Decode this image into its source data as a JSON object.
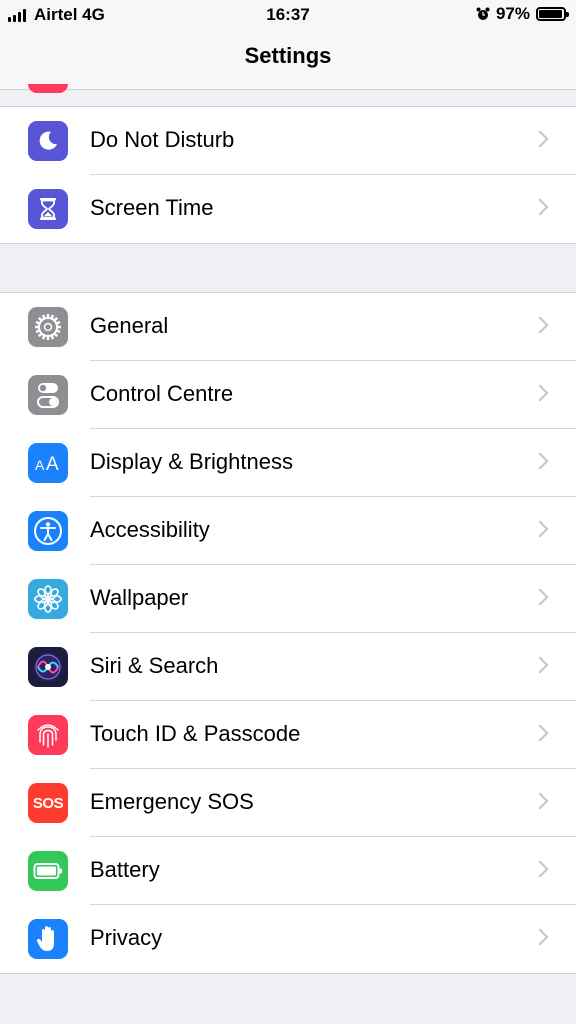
{
  "status_bar": {
    "carrier": "Airtel 4G",
    "time": "16:37",
    "battery": "97%",
    "battery_level": 0.97
  },
  "nav": {
    "title": "Settings"
  },
  "group1": [
    {
      "label": "Do Not Disturb",
      "icon": "moon-icon",
      "color": "#5856d6"
    },
    {
      "label": "Screen Time",
      "icon": "hourglass-icon",
      "color": "#5856d6"
    }
  ],
  "group2": [
    {
      "label": "General",
      "icon": "gear-icon",
      "color": "#8e8e93"
    },
    {
      "label": "Control Centre",
      "icon": "toggles-icon",
      "color": "#8e8e93"
    },
    {
      "label": "Display & Brightness",
      "icon": "text-size-icon",
      "color": "#1a82fb"
    },
    {
      "label": "Accessibility",
      "icon": "accessibility-icon",
      "color": "#1a82fb"
    },
    {
      "label": "Wallpaper",
      "icon": "flower-icon",
      "color": "#36aadc"
    },
    {
      "label": "Siri & Search",
      "icon": "siri-icon",
      "color": "#1c1c3c"
    },
    {
      "label": "Touch ID & Passcode",
      "icon": "fingerprint-icon",
      "color": "#ff3b5c"
    },
    {
      "label": "Emergency SOS",
      "icon": "sos-icon",
      "color": "#ff3b30",
      "icon_text": "SOS"
    },
    {
      "label": "Battery",
      "icon": "battery-icon",
      "color": "#34c759"
    },
    {
      "label": "Privacy",
      "icon": "hand-icon",
      "color": "#1a82fb"
    }
  ]
}
